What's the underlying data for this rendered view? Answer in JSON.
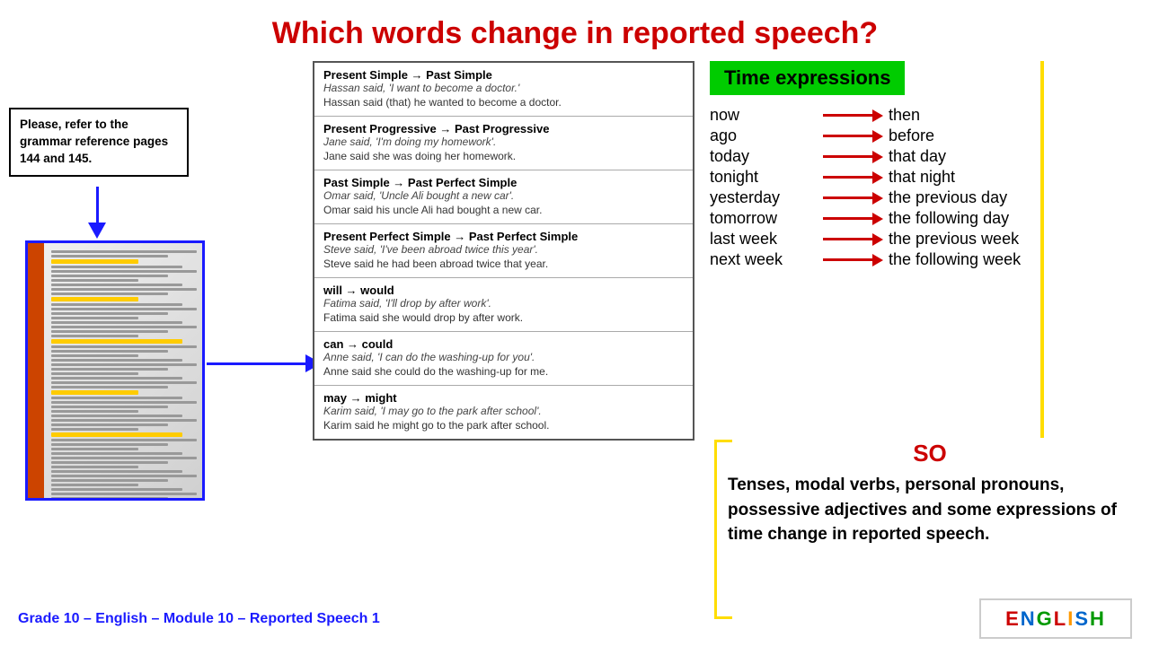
{
  "title": "Which words change in reported speech?",
  "left_box": {
    "text": "Please, refer to the grammar reference pages 144 and 145."
  },
  "grammar_sections": [
    {
      "heading": "Present Simple → Past Simple",
      "lines": [
        "Hassan said, 'I want to become a doctor.'",
        "Hassan said (that) he wanted to become a doctor."
      ]
    },
    {
      "heading": "Present Progressive → Past Progressive",
      "lines": [
        "Jane said, 'I'm doing my homework'.",
        "Jane said she was doing her homework."
      ]
    },
    {
      "heading": "Past Simple → Past Perfect Simple",
      "lines": [
        "Omar said, 'Uncle Ali bought a new car'.",
        "Omar said his uncle Ali had bought a new car."
      ]
    },
    {
      "heading": "Present Perfect Simple → Past Perfect Simple",
      "lines": [
        "Steve said, 'I've been abroad twice this year'.",
        "Steve said he had been abroad twice that year."
      ]
    },
    {
      "heading": "will → would",
      "lines": [
        "Fatima said, 'I'll drop by after work'.",
        "Fatima said she would drop by after work."
      ]
    },
    {
      "heading": "can → could",
      "lines": [
        "Anne said, 'I can do the washing-up for you'.",
        "Anne said she could do the washing-up for me."
      ]
    },
    {
      "heading": "may → might",
      "lines": [
        "Karim said, 'I may go to the park after school'.",
        "Karim said he might go to the park after school."
      ]
    }
  ],
  "time_expressions": {
    "header": "Time expressions",
    "pairs": [
      {
        "from": "now",
        "to": "then"
      },
      {
        "from": "ago",
        "to": "before"
      },
      {
        "from": "today",
        "to": "that day"
      },
      {
        "from": "tonight",
        "to": "that night"
      },
      {
        "from": "yesterday",
        "to": "the previous day"
      },
      {
        "from": "tomorrow",
        "to": "the following day"
      },
      {
        "from": "last week",
        "to": "the previous week"
      },
      {
        "from": "next week",
        "to": "the following week"
      }
    ]
  },
  "so_section": {
    "label": "SO",
    "text": "Tenses, modal verbs, personal pronouns, possessive adjectives and some expressions of time change in reported speech."
  },
  "footer": {
    "text": "Grade 10 – English – Module 10 – Reported Speech 1",
    "logo": "ENGLISH"
  }
}
